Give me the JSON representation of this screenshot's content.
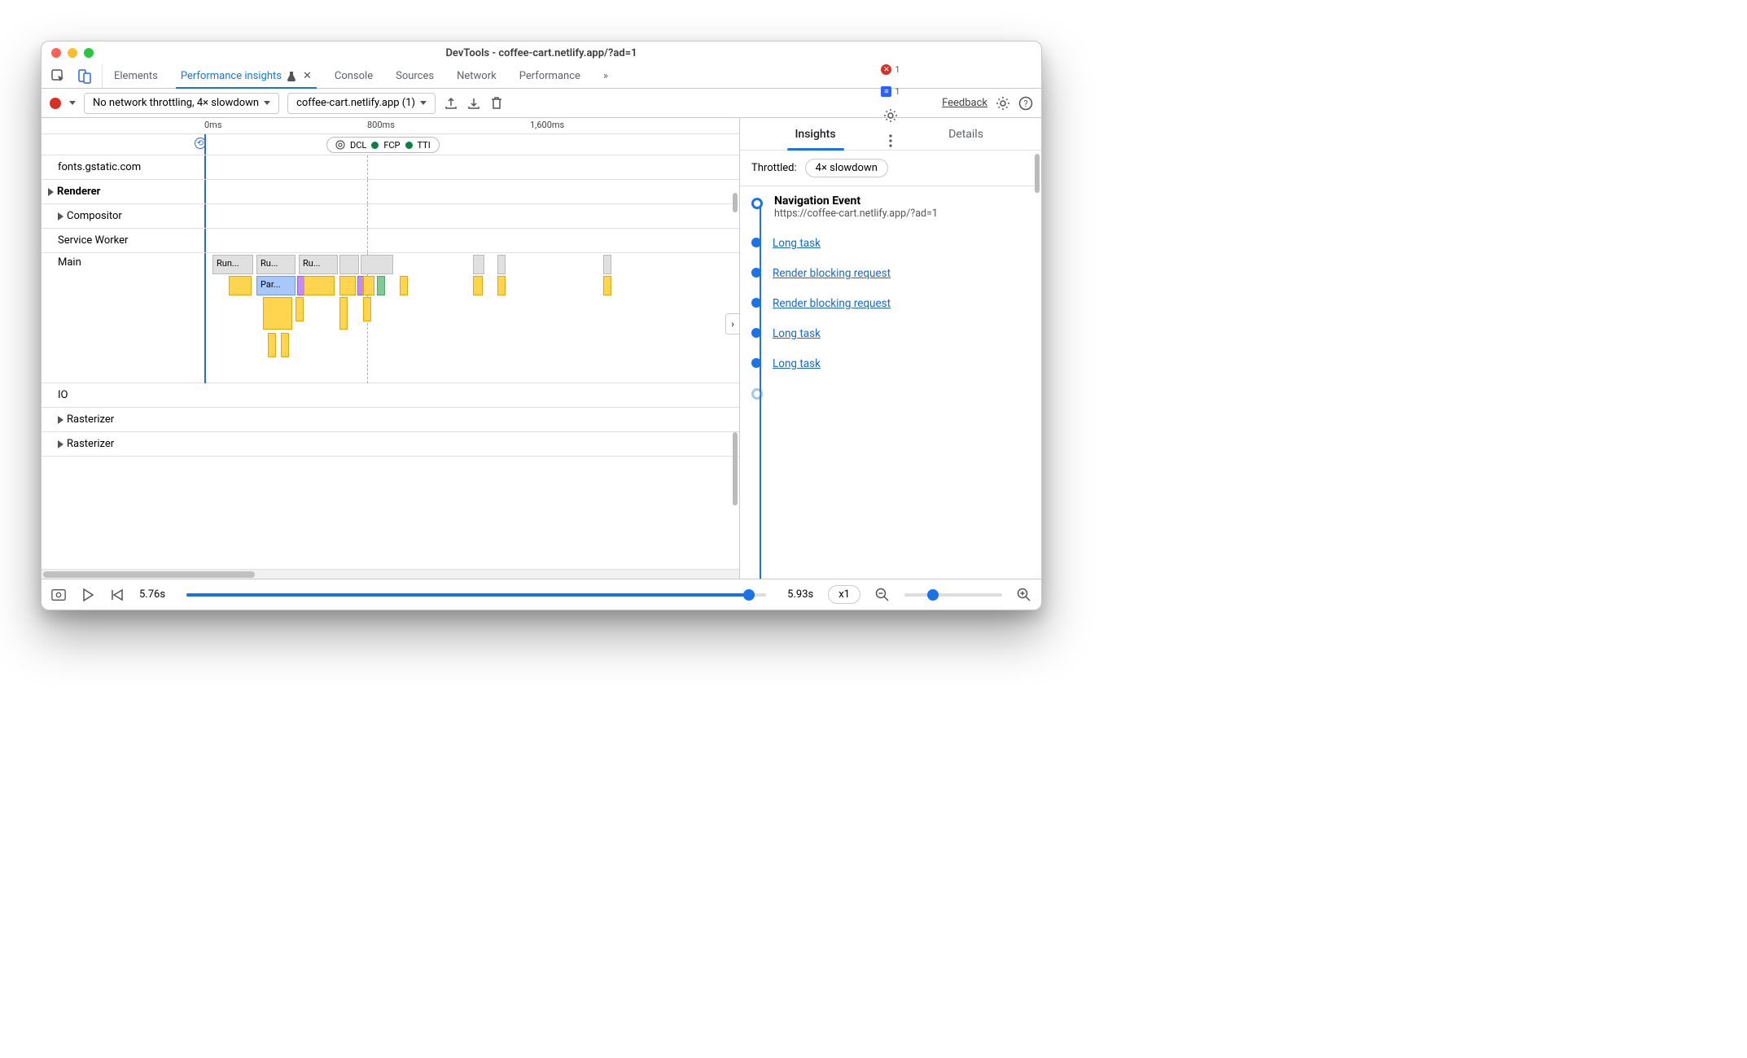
{
  "window_title": "DevTools - coffee-cart.netlify.app/?ad=1",
  "top_tabs": {
    "elements": "Elements",
    "perf_insights": "Performance insights",
    "console": "Console",
    "sources": "Sources",
    "network": "Network",
    "performance": "Performance",
    "overflow": "»"
  },
  "top_badges": {
    "errors": "1",
    "messages": "1"
  },
  "toolbar": {
    "throttle_sel": "No network throttling, 4× slowdown",
    "page_sel": "coffee-cart.netlify.app (1)",
    "feedback": "Feedback"
  },
  "ruler": {
    "t0": "0ms",
    "t1": "800ms",
    "t2": "1,600ms"
  },
  "markers": {
    "dcl": "DCL",
    "fcp": "FCP",
    "tti": "TTI"
  },
  "tracks": {
    "fonts": "fonts.gstatic.com",
    "renderer": "Renderer",
    "compositor": "Compositor",
    "service_worker": "Service Worker",
    "main": "Main",
    "io": "IO",
    "rasterizer": "Rasterizer",
    "main_blocks": {
      "run": "Run...",
      "ru": "Ru...",
      "par": "Par..."
    }
  },
  "right": {
    "tab_insights": "Insights",
    "tab_details": "Details",
    "throttled_label": "Throttled:",
    "throttled_value": "4× slowdown",
    "nav_title": "Navigation Event",
    "nav_url": "https://coffee-cart.netlify.app/?ad=1",
    "items": [
      "Long task",
      "Render blocking request",
      "Render blocking request",
      "Long task",
      "Long task"
    ]
  },
  "player": {
    "t_current": "5.76s",
    "t_total": "5.93s",
    "speed": "x1"
  }
}
